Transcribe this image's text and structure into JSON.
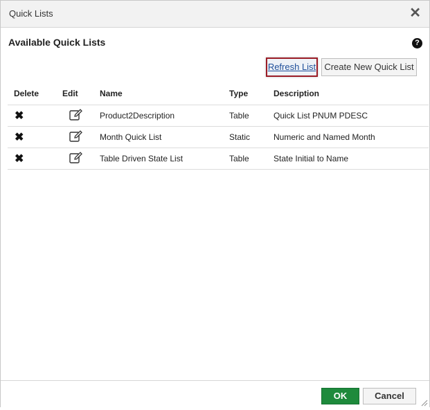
{
  "dialog": {
    "title": "Quick Lists",
    "close_glyph": "✕"
  },
  "section": {
    "title": "Available Quick Lists",
    "help_glyph": "?"
  },
  "toolbar": {
    "refresh_label": "Refresh List",
    "create_label": "Create New Quick List"
  },
  "table": {
    "headers": {
      "delete": "Delete",
      "edit": "Edit",
      "name": "Name",
      "type": "Type",
      "description": "Description"
    },
    "rows": [
      {
        "name": "Product2Description",
        "type": "Table",
        "description": "Quick List PNUM PDESC"
      },
      {
        "name": "Month Quick List",
        "type": "Static",
        "description": "Numeric and Named Month"
      },
      {
        "name": "Table Driven State List",
        "type": "Table",
        "description": "State Initial to Name"
      }
    ],
    "delete_glyph": "✖"
  },
  "footer": {
    "ok_label": "OK",
    "cancel_label": "Cancel"
  },
  "colors": {
    "ok_green": "#1e8a3c",
    "refresh_highlight": "#9b1c26",
    "link_blue": "#1f4f9a"
  }
}
